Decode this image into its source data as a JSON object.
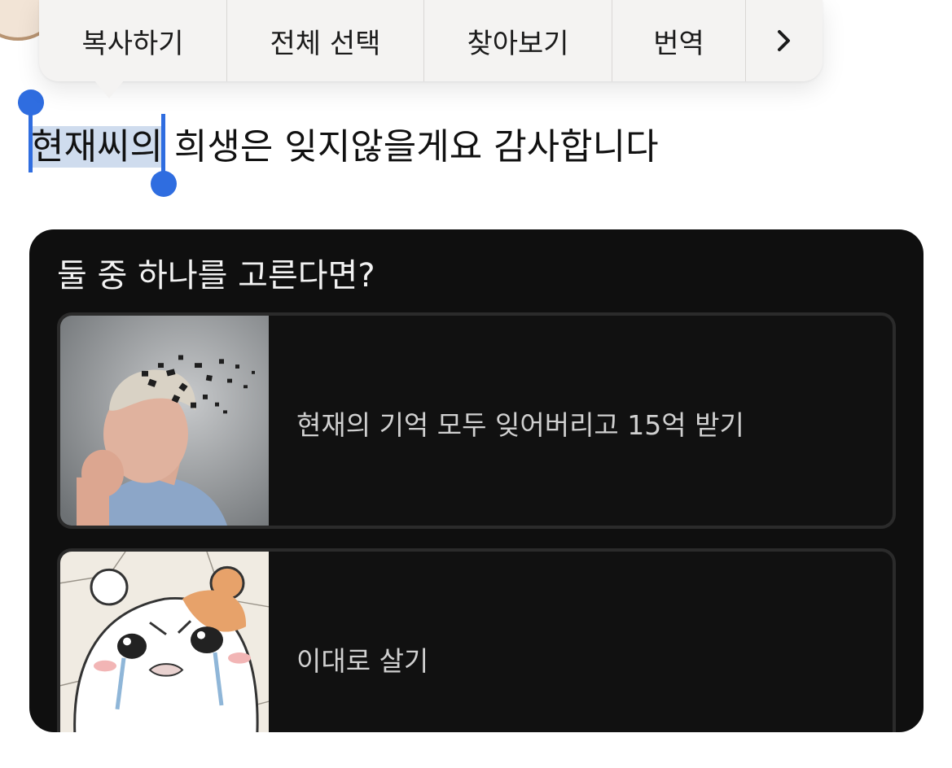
{
  "context_menu": {
    "items": [
      "복사하기",
      "전체 선택",
      "찾아보기",
      "번역"
    ],
    "more_icon": "chevron-right-icon",
    "more_glyph": "›"
  },
  "text": {
    "selected": "현재씨의",
    "rest": " 희생은 잊지않을게요 감사합니다"
  },
  "card": {
    "title": "둘 중 하나를 고른다면?",
    "options": [
      {
        "label": "현재의 기억 모두 잊어버리고 15억 받기",
        "image": "elderly-woman-memory-loss-image"
      },
      {
        "label": "이대로 살기",
        "image": "crying-hamster-cartoon-image"
      }
    ]
  },
  "colors": {
    "selection_highlight": "#cfdcee",
    "selection_handle": "#2f6de0",
    "card_bg": "#0f0f0f"
  }
}
